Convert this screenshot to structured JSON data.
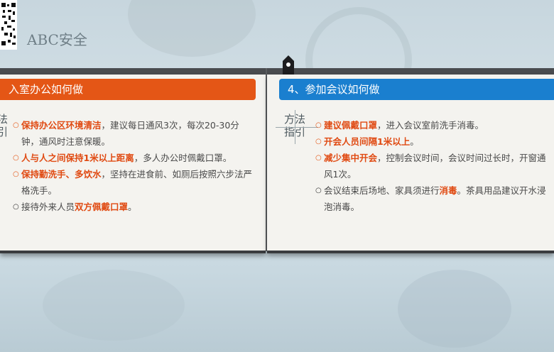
{
  "brand": "ABC安全",
  "left_card": {
    "title": "入室办公如何做",
    "tag": [
      "法",
      "引"
    ],
    "items": [
      {
        "hl": "保持办公区环境清洁",
        "rest": "，建议每日通风3次，每次20-30分钟，通风时注意保暖。"
      },
      {
        "hl": "人与人之间保持1米以上距离",
        "rest": "，多人办公时佩戴口罩。"
      },
      {
        "hl": "保持勤洗手、多饮水",
        "rest": "，坚持在进食前、如厕后按照六步法严格洗手。"
      },
      {
        "pre": "接待外来人员",
        "hl": "双方佩戴口罩",
        "rest": "。"
      }
    ]
  },
  "right_card": {
    "title": "4、参加会议如何做",
    "tag": [
      "方法",
      "指引"
    ],
    "items": [
      {
        "hl": "建议佩戴口罩",
        "rest": "，进入会议室前洗手消毒。"
      },
      {
        "hl": "开会人员间隔1米以上",
        "rest": "。"
      },
      {
        "hl": "减少集中开会",
        "rest": "，控制会议时间，会议时间过长时，开窗通风1次。"
      },
      {
        "pre": "会议结束后场地、家具须进行",
        "hl": "消毒",
        "rest": "。茶具用品建议开水浸泡消毒。"
      }
    ]
  },
  "colors": {
    "orange": "#e45616",
    "blue": "#1a7fcf",
    "highlight": "#e04a12"
  }
}
